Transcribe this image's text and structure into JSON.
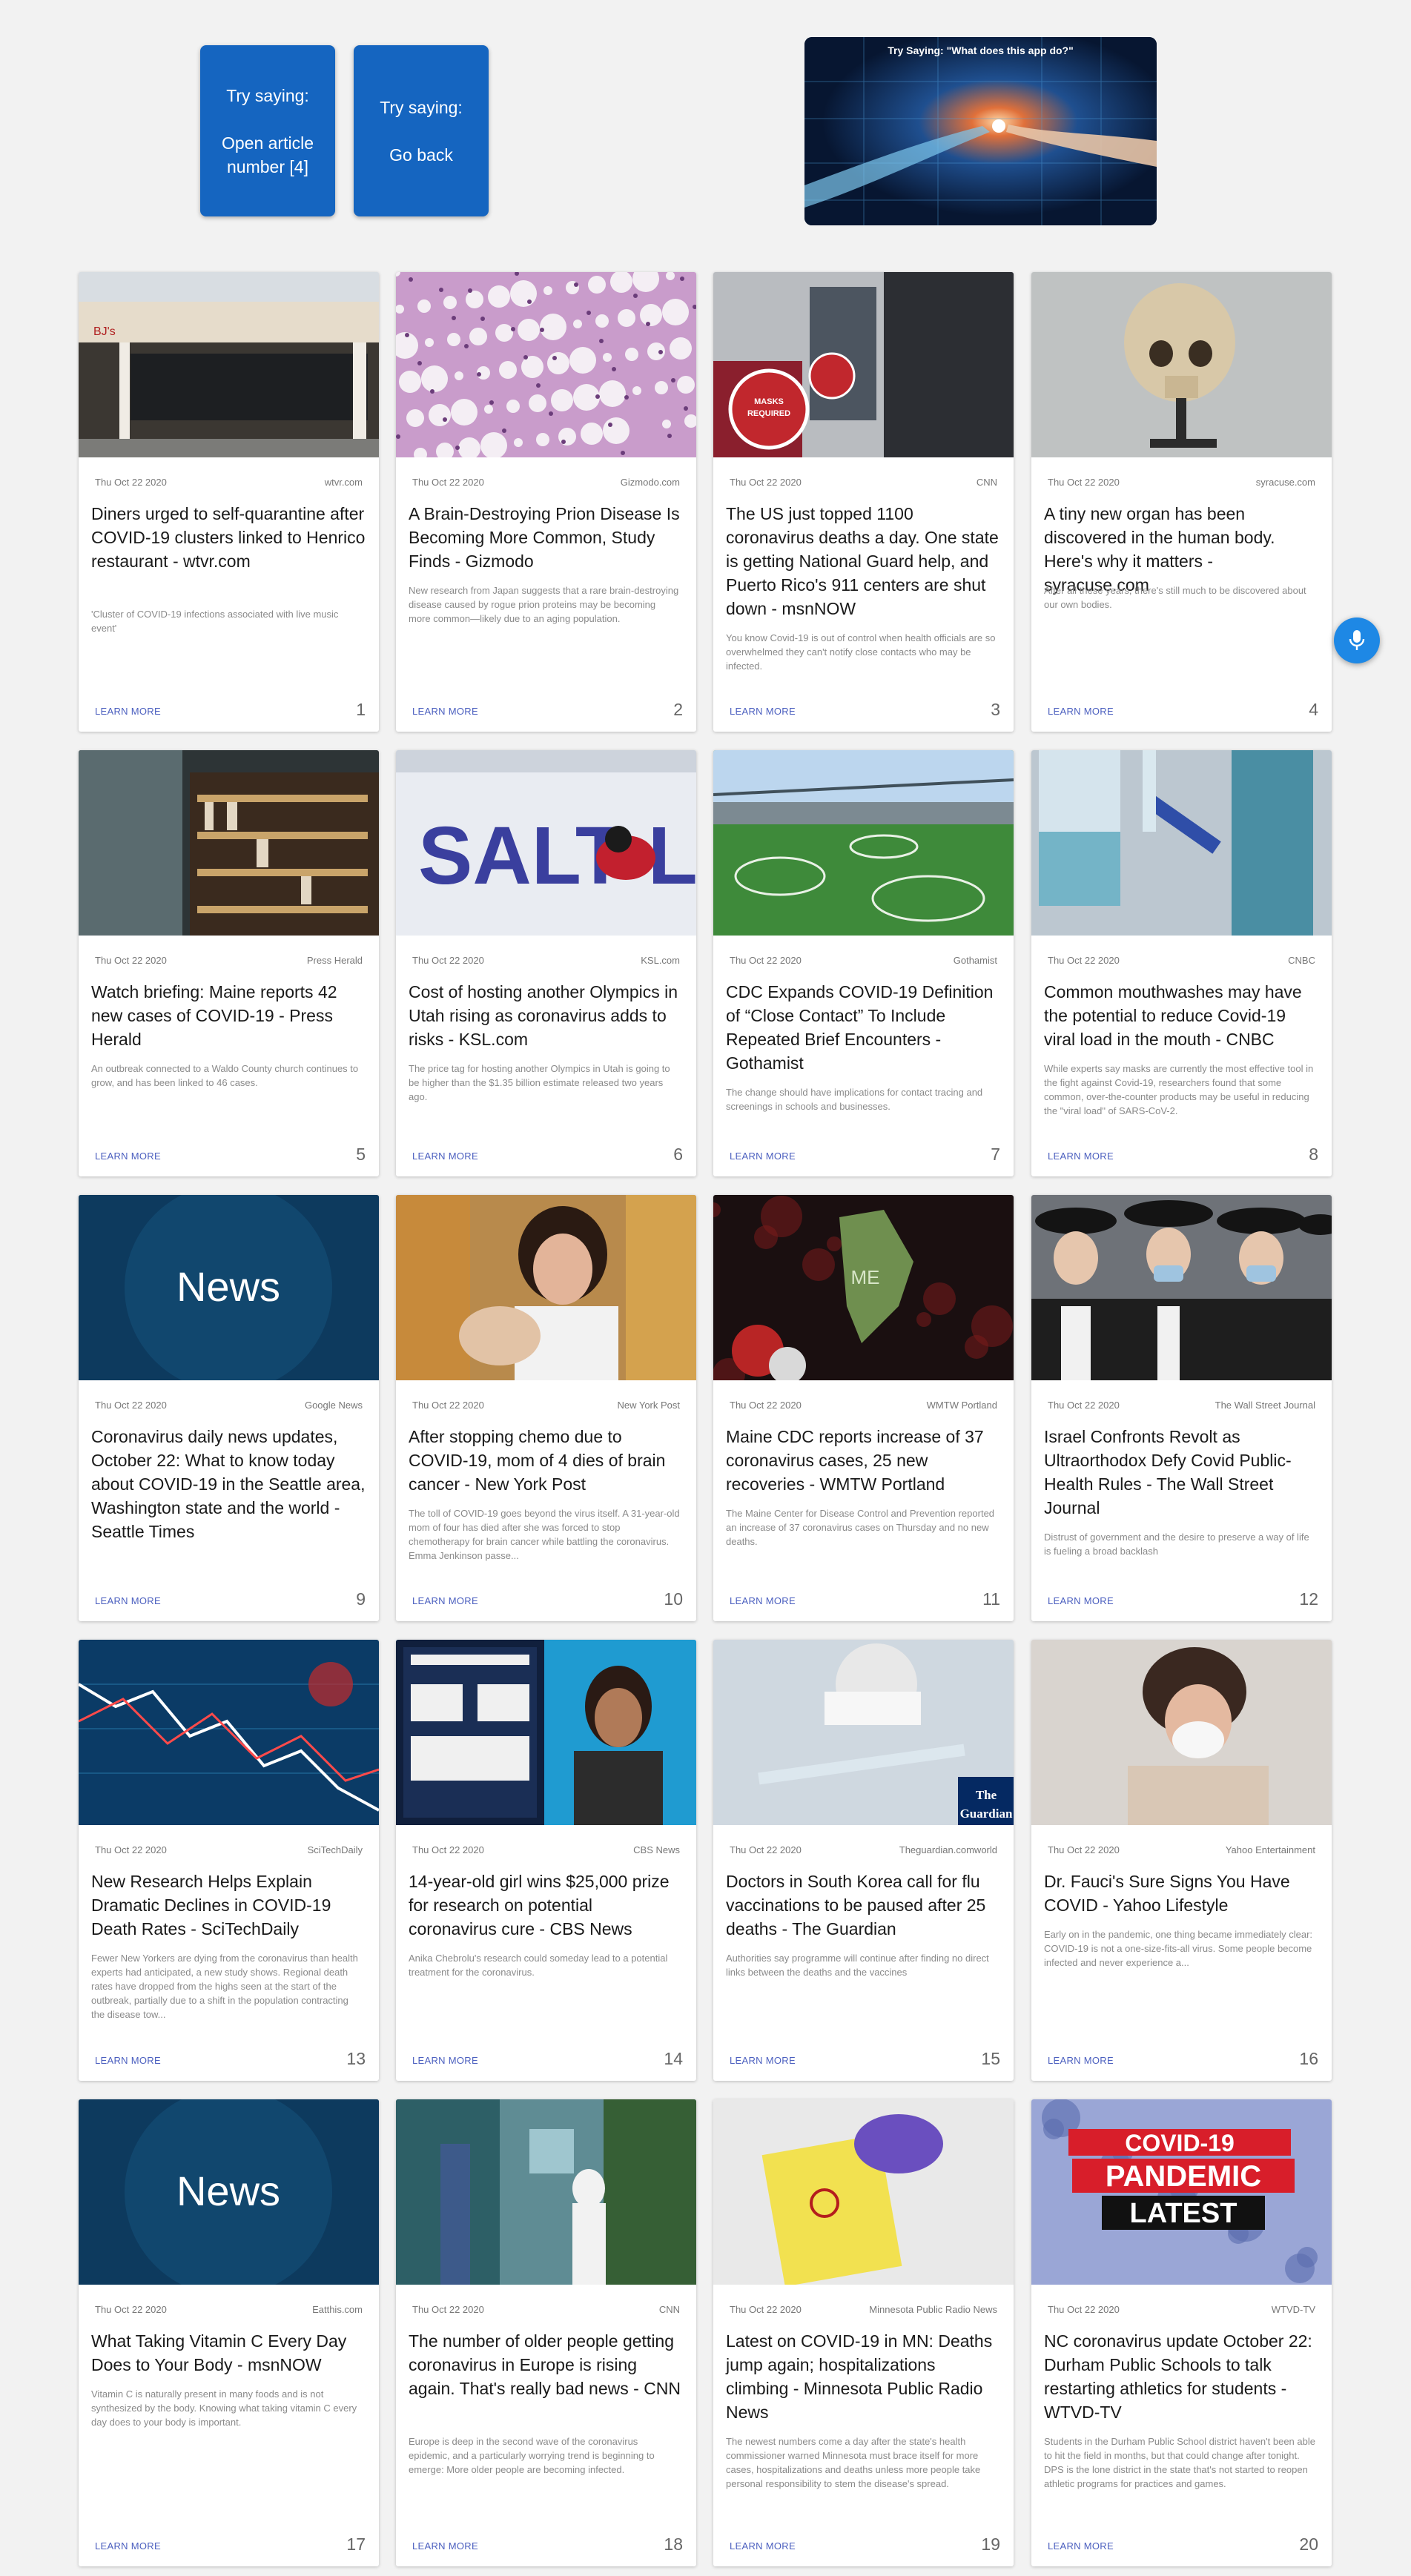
{
  "hints": [
    {
      "label": "Try saying:",
      "command": "Open article number [4]"
    },
    {
      "label": "Try saying:",
      "command": "Go back"
    }
  ],
  "banner": {
    "title": "Try Saying: \"What does this app do?\""
  },
  "learn_more": "LEARN MORE",
  "news_logo": "News",
  "cards": [
    {
      "date": "Thu Oct 22 2020",
      "source": "wtvr.com",
      "title": "Diners urged to self-quarantine after COVID-19 clusters linked to Henrico restaurant - wtvr.com",
      "desc": "'Cluster of COVID-19 infections associated with live music event'",
      "num": "1",
      "image": "restaurant-photo"
    },
    {
      "date": "Thu Oct 22 2020",
      "source": "Gizmodo.com",
      "title": "A Brain-Destroying Prion Disease Is Becoming More Common, Study Finds - Gizmodo",
      "desc": "New research from Japan suggests that a rare brain-destroying disease caused by rogue prion proteins may be becoming more common—likely due to an aging population.",
      "num": "2",
      "image": "prion-tissue-photo"
    },
    {
      "date": "Thu Oct 22 2020",
      "source": "CNN",
      "title": "The US just topped 1100 coronavirus deaths a day. One state is getting National Guard help, and Puerto Rico's 911 centers are shut down - msnNOW",
      "desc": "You know Covid-19 is out of control when health officials are so overwhelmed they can't notify close contacts who may be infected.",
      "num": "3",
      "image": "masks-required-photo",
      "img_text": "MASKS REQUIRED"
    },
    {
      "date": "Thu Oct 22 2020",
      "source": "syracuse.com",
      "title": "A tiny new organ has been discovered in the human body. Here's why it matters - syracuse.com",
      "desc": "After all these years, there's still much to be discovered about our own bodies.",
      "num": "4",
      "image": "skull-photo"
    },
    {
      "date": "Thu Oct 22 2020",
      "source": "Press Herald",
      "title": "Watch briefing: Maine reports 42 new cases of COVID-19 - Press Herald",
      "desc": "An outbreak connected to a Waldo County church continues to grow, and has been linked to 46 cases.",
      "num": "5",
      "image": "bookstore-photo"
    },
    {
      "date": "Thu Oct 22 2020",
      "source": "KSL.com",
      "title": "Cost of hosting another Olympics in Utah rising as coronavirus adds to risks - KSL.com",
      "desc": "The price tag for hosting another Olympics in Utah is going to be higher than the $1.35 billion estimate released two years ago.",
      "num": "6",
      "image": "salt-lake-luge-photo",
      "img_text": "SALT LAK"
    },
    {
      "date": "Thu Oct 22 2020",
      "source": "Gothamist",
      "title": "CDC Expands COVID-19 Definition of “Close Contact” To Include Repeated Brief Encounters - Gothamist",
      "desc": "The change should have implications for contact tracing and screenings in schools and businesses.",
      "num": "7",
      "image": "park-circles-photo"
    },
    {
      "date": "Thu Oct 22 2020",
      "source": "CNBC",
      "title": "Common mouthwashes may have the potential to reduce Covid-19 viral load in the mouth - CNBC",
      "desc": "While experts say masks are currently the most effective tool in the fight against Covid-19, researchers found that some common, over-the-counter products may be useful in reducing the \"viral load\" of SARS-CoV-2.",
      "num": "8",
      "image": "mouthwash-photo"
    },
    {
      "date": "Thu Oct 22 2020",
      "source": "Google News",
      "title": "Coronavirus daily news updates, October 22: What to know today about COVID-19 in the Seattle area, Washington state and the world - Seattle Times",
      "desc": "",
      "num": "9",
      "image": "news-logo"
    },
    {
      "date": "Thu Oct 22 2020",
      "source": "New York Post",
      "title": "After stopping chemo due to COVID-19, mom of 4 dies of brain cancer - New York Post",
      "desc": "The toll of COVID-19 goes beyond the virus itself. A 31-year-old mom of four has died after she was forced to stop chemotherapy for brain cancer while battling the coronavirus. Emma Jenkinson passe...",
      "num": "10",
      "image": "mother-baby-photo"
    },
    {
      "date": "Thu Oct 22 2020",
      "source": "WMTW Portland",
      "title": "Maine CDC reports increase of 37 coronavirus cases, 25 new recoveries - WMTW Portland",
      "desc": "The Maine Center for Disease Control and Prevention reported an increase of 37 coronavirus cases on Thursday and no new deaths.",
      "num": "11",
      "image": "maine-map-virus",
      "img_text": "ME"
    },
    {
      "date": "Thu Oct 22 2020",
      "source": "The Wall Street Journal",
      "title": "Israel Confronts Revolt as Ultraorthodox Defy Covid Public-Health Rules - The Wall Street Journal",
      "desc": "Distrust of government and the desire to preserve a way of life is fueling a broad backlash",
      "num": "12",
      "image": "crowd-hats-photo"
    },
    {
      "date": "Thu Oct 22 2020",
      "source": "SciTechDaily",
      "title": "New Research Helps Explain Dramatic Declines in COVID-19 Death Rates - SciTechDaily",
      "desc": "Fewer New Yorkers are dying from the coronavirus than health experts had anticipated, a new study shows. Regional death rates have dropped from the highs seen at the start of the outbreak, partially due to a shift in the population contracting the disease tow...",
      "num": "13",
      "image": "stock-chart-graphic"
    },
    {
      "date": "Thu Oct 22 2020",
      "source": "CBS News",
      "title": "14-year-old girl wins $25,000 prize for research on potential coronavirus cure - CBS News",
      "desc": "Anika Chebrolu's research could someday lead to a potential treatment for the coronavirus.",
      "num": "14",
      "image": "student-poster-photo"
    },
    {
      "date": "Thu Oct 22 2020",
      "source": "Theguardian.comworld",
      "title": "Doctors in South Korea call for flu vaccinations to be paused after 25 deaths - The Guardian",
      "desc": "Authorities say programme will continue after finding no direct links between the deaths and the vaccines",
      "num": "15",
      "image": "vaccine-syringe-photo",
      "img_text": "The Guardian"
    },
    {
      "date": "Thu Oct 22 2020",
      "source": "Yahoo Entertainment",
      "title": "Dr. Fauci's Sure Signs You Have COVID - Yahoo Lifestyle",
      "desc": "Early on in the pandemic, one thing became immediately clear: COVID-19 is not a one-size-fits-all virus. Some people become infected and never experience a...",
      "num": "16",
      "image": "sick-woman-photo"
    },
    {
      "date": "Thu Oct 22 2020",
      "source": "Eatthis.com",
      "title": "What Taking Vitamin C Every Day Does to Your Body - msnNOW",
      "desc": "Vitamin C is naturally present in many foods and is not synthesized by the body. Knowing what taking vitamin C every day does to your body is important.",
      "num": "17",
      "image": "news-logo"
    },
    {
      "date": "Thu Oct 22 2020",
      "source": "CNN",
      "title": "The number of older people getting coronavirus in Europe is rising again. That's really bad news - CNN",
      "desc": "Europe is deep in the second wave of the coronavirus epidemic, and a particularly worrying trend is beginning to emerge: More older people are becoming infected.",
      "num": "18",
      "image": "hospital-corridor-photo"
    },
    {
      "date": "Thu Oct 22 2020",
      "source": "Minnesota Public Radio News",
      "title": "Latest on COVID-19 in MN: Deaths jump again; hospitalizations climbing - Minnesota Public Radio News",
      "desc": "The newest numbers come a day after the state's health commissioner warned Minnesota must brace itself for more cases, hospitalizations and deaths unless more people take personal responsibility to stem the disease's spread.",
      "num": "19",
      "image": "biohazard-bag-photo"
    },
    {
      "date": "Thu Oct 22 2020",
      "source": "WTVD-TV",
      "title": "NC coronavirus update October 22: Durham Public Schools to talk restarting athletics for students - WTVD-TV",
      "desc": "Students in the Durham Public School district haven't been able to hit the field in months, but that could change after tonight. DPS is the lone district in the state that's not started to reopen athletic programs for practices and games.",
      "num": "20",
      "image": "covid-pandemic-latest-graphic",
      "img_text": [
        "COVID-19",
        "PANDEMIC",
        "LATEST"
      ]
    }
  ]
}
